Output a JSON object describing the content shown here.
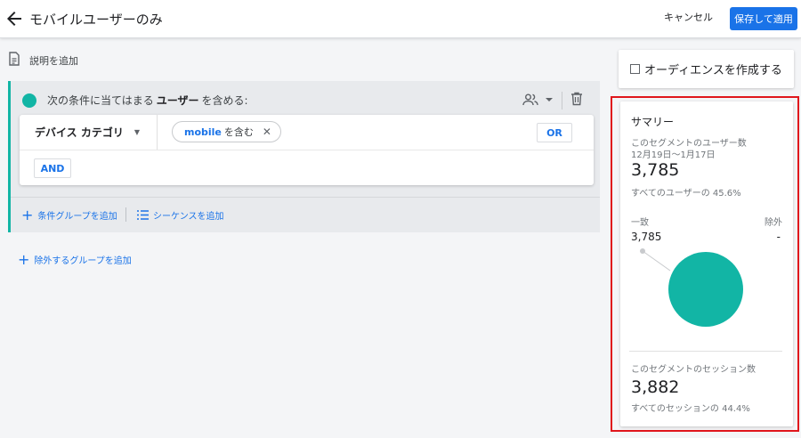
{
  "header": {
    "title": "モバイルユーザーのみ",
    "cancel_label": "キャンセル",
    "save_label": "保存して適用"
  },
  "description": {
    "label": "説明を追加"
  },
  "condition_group": {
    "prefix": "次の条件に当てはまる",
    "scope": "ユーザー",
    "suffix": "を含める:",
    "dimension": "デバイス カテゴリ",
    "chip_keyword": "mobile",
    "chip_text": "を含む",
    "or_label": "OR",
    "and_label": "AND",
    "add_condition_group": "条件グループを追加",
    "add_sequence": "シーケンスを追加"
  },
  "add_exclude_group": "除外するグループを追加",
  "audience_button": "オーディエンスを作成する",
  "summary": {
    "title": "サマリー",
    "users_label": "このセグメントのユーザー数",
    "date_range": "12月19日〜1月17日",
    "users_value": "3,785",
    "users_pct": "すべてのユーザーの 45.6%",
    "match_label": "一致",
    "exclude_label": "除外",
    "match_value": "3,785",
    "exclude_value": "-",
    "sessions_label": "このセグメントのセッション数",
    "sessions_value": "3,882",
    "sessions_pct": "すべてのセッションの 44.4%"
  },
  "pie": {
    "match_fraction": 1.0,
    "color": "#12b5a5"
  }
}
